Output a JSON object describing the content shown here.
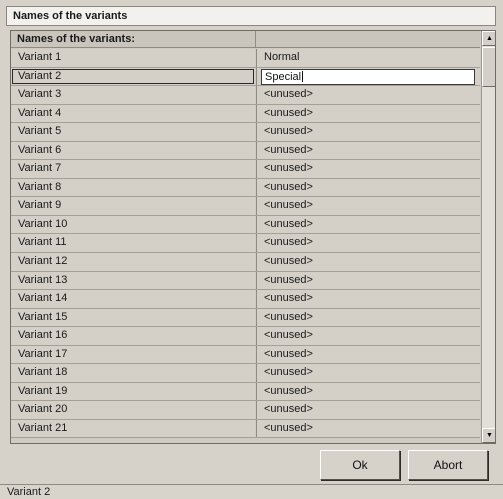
{
  "window": {
    "title": "Names of the variants"
  },
  "grid": {
    "header": "Names of the variants:",
    "rows": [
      {
        "name": "Variant 1",
        "value": "Normal"
      },
      {
        "name": "Variant 2",
        "value": "Special"
      },
      {
        "name": "Variant 3",
        "value": "<unused>"
      },
      {
        "name": "Variant 4",
        "value": "<unused>"
      },
      {
        "name": "Variant 5",
        "value": "<unused>"
      },
      {
        "name": "Variant 6",
        "value": "<unused>"
      },
      {
        "name": "Variant 7",
        "value": "<unused>"
      },
      {
        "name": "Variant 8",
        "value": "<unused>"
      },
      {
        "name": "Variant 9",
        "value": "<unused>"
      },
      {
        "name": "Variant 10",
        "value": "<unused>"
      },
      {
        "name": "Variant 11",
        "value": "<unused>"
      },
      {
        "name": "Variant 12",
        "value": "<unused>"
      },
      {
        "name": "Variant 13",
        "value": "<unused>"
      },
      {
        "name": "Variant 14",
        "value": "<unused>"
      },
      {
        "name": "Variant 15",
        "value": "<unused>"
      },
      {
        "name": "Variant 16",
        "value": "<unused>"
      },
      {
        "name": "Variant 17",
        "value": "<unused>"
      },
      {
        "name": "Variant 18",
        "value": "<unused>"
      },
      {
        "name": "Variant 19",
        "value": "<unused>"
      },
      {
        "name": "Variant 20",
        "value": "<unused>"
      },
      {
        "name": "Variant 21",
        "value": "<unused>"
      }
    ],
    "editing_row": 1
  },
  "buttons": {
    "ok": "Ok",
    "abort": "Abort"
  },
  "status": {
    "text": "Variant 2"
  },
  "icons": {
    "scroll_up": "scroll-up-arrow-icon",
    "scroll_down": "scroll-down-arrow-icon"
  }
}
